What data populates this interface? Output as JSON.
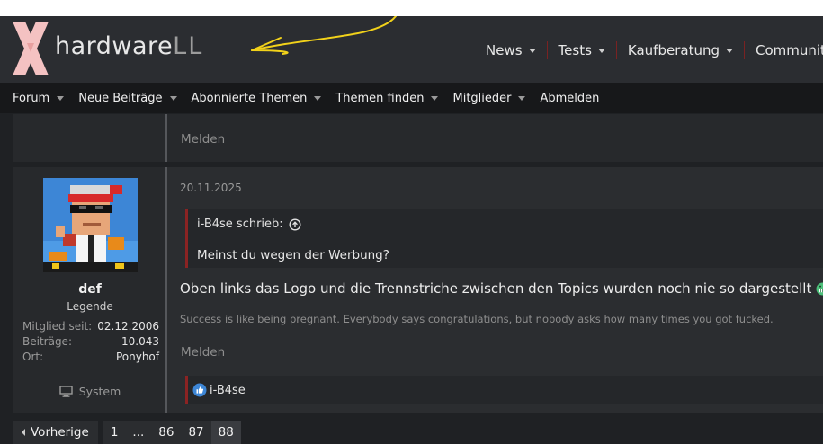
{
  "header": {
    "logo_text": "hardware",
    "logo_suffix": "LL",
    "main_nav": [
      {
        "label": "News"
      },
      {
        "label": "Tests"
      },
      {
        "label": "Kaufberatung"
      },
      {
        "label": "Community"
      }
    ]
  },
  "subnav": [
    {
      "label": "Forum",
      "caret": true
    },
    {
      "label": "Neue Beiträge",
      "caret": true
    },
    {
      "label": "Abonnierte Themen",
      "caret": true
    },
    {
      "label": "Themen finden",
      "caret": true
    },
    {
      "label": "Mitglieder",
      "caret": true
    },
    {
      "label": "Abmelden",
      "caret": false
    }
  ],
  "previous_post": {
    "report_label": "Melden"
  },
  "post": {
    "author": {
      "name": "def",
      "title": "Legende",
      "stats": [
        {
          "key": "Mitglied seit:",
          "value": "02.12.2006"
        },
        {
          "key": "Beiträge:",
          "value": "10.043"
        },
        {
          "key": "Ort:",
          "value": "Ponyhof"
        }
      ],
      "system_label": "System"
    },
    "date": "20.11.2025",
    "quote": {
      "author_label": "i-B4se schrieb:",
      "text": "Meinst du wegen der Werbung?"
    },
    "message": "Oben links das Logo und die Trennstriche zwischen den Topics wurden noch nie so dargestellt",
    "signature": "Success is like being pregnant. Everybody says congratulations, but nobody asks how many times you got fucked.",
    "report_label": "Melden",
    "reactions": {
      "users": "i-B4se"
    }
  },
  "pagination": {
    "prev_label": "Vorherige",
    "pages": [
      "1",
      "...",
      "86",
      "87",
      "88"
    ],
    "current": "88"
  },
  "colors": {
    "accent": "#8b2323",
    "background": "#1f2124",
    "annotation_arrow": "#f2d21a",
    "like_blue": "#3d86d6"
  }
}
